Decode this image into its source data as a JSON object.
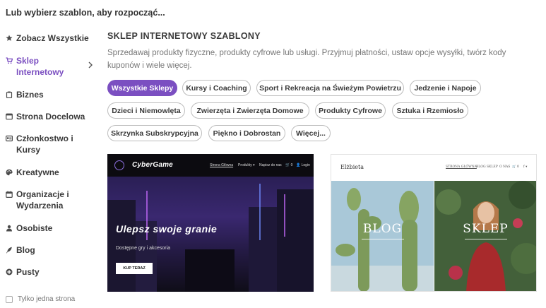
{
  "heading": "Lub wybierz szablon, aby rozpocząć...",
  "sidebar": {
    "items": [
      {
        "label": "Zobacz Wszystkie",
        "icon": "star-icon"
      },
      {
        "label": "Sklep Internetowy",
        "icon": "cart-icon",
        "active": true
      },
      {
        "label": "Biznes",
        "icon": "clipboard-icon"
      },
      {
        "label": "Strona Docelowa",
        "icon": "window-icon"
      },
      {
        "label": "Członkostwo i Kursy",
        "icon": "id-card-icon"
      },
      {
        "label": "Kreatywne",
        "icon": "palette-icon"
      },
      {
        "label": "Organizacje i Wydarzenia",
        "icon": "calendar-icon"
      },
      {
        "label": "Osobiste",
        "icon": "user-icon"
      },
      {
        "label": "Blog",
        "icon": "feather-icon"
      },
      {
        "label": "Pusty",
        "icon": "plus-circle-icon"
      }
    ],
    "checkbox_label": "Tylko jedna strona"
  },
  "main": {
    "title": "SKLEP INTERNETOWY SZABLONY",
    "description": "Sprzedawaj produkty fizyczne, produkty cyfrowe lub usługi. Przyjmuj płatności, ustaw opcje wysyłki, twórz kody kuponów i wiele więcej.",
    "chips": [
      "Wszystkie Sklepy",
      "Kursy i Coaching",
      "Sport i Rekreacja na Świeżym Powietrzu",
      "Jedzenie i Napoje",
      "Dzieci i Niemowlęta",
      "Zwierzęta i Zwierzęta Domowe",
      "Produkty Cyfrowe",
      "Sztuka i Rzemiosło",
      "Skrzynka Subskrypcyjna",
      "Piękno i Dobrostan",
      "Więcej..."
    ],
    "active_chip": "Wszystkie Sklepy"
  },
  "templates": {
    "cybergame": {
      "logo": "CyberGame",
      "nav": {
        "home": "Strona Główna",
        "products": "Produkty ▾",
        "contact": "Napisz do nas",
        "cart": "🛒 0",
        "login": "👤 Login"
      },
      "headline": "Ulepsz swoje granie",
      "subtitle": "Dostępne gry i akcesoria",
      "button": "KUP TERAZ"
    },
    "elzbieta": {
      "brand": "Elżbieta",
      "nav": {
        "home": "STRONA GŁÓWNA",
        "blog": "BLOG",
        "shop": "SKLEP",
        "about": "O NAS",
        "cart": "🛒 0",
        "social": "f ▾"
      },
      "left_label": "BLOG",
      "right_label": "SKLEP"
    }
  },
  "colors": {
    "accent": "#7b4fc1"
  }
}
